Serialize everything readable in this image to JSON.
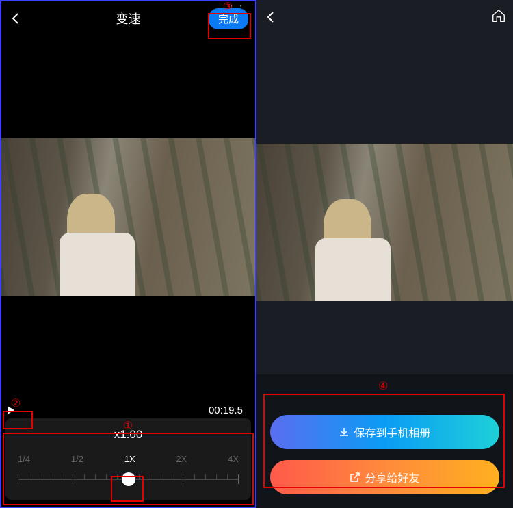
{
  "left": {
    "header": {
      "title": "变速",
      "done": "完成"
    },
    "time": "00:19.5",
    "speed": {
      "value": "x1.00",
      "labels": [
        "1/4",
        "1/2",
        "1X",
        "2X",
        "4X"
      ]
    },
    "annotations": {
      "one": "①",
      "two": "②",
      "three": "③"
    }
  },
  "right": {
    "actions": {
      "save": "保存到手机相册",
      "share": "分享给好友"
    },
    "annotations": {
      "four": "④"
    }
  }
}
